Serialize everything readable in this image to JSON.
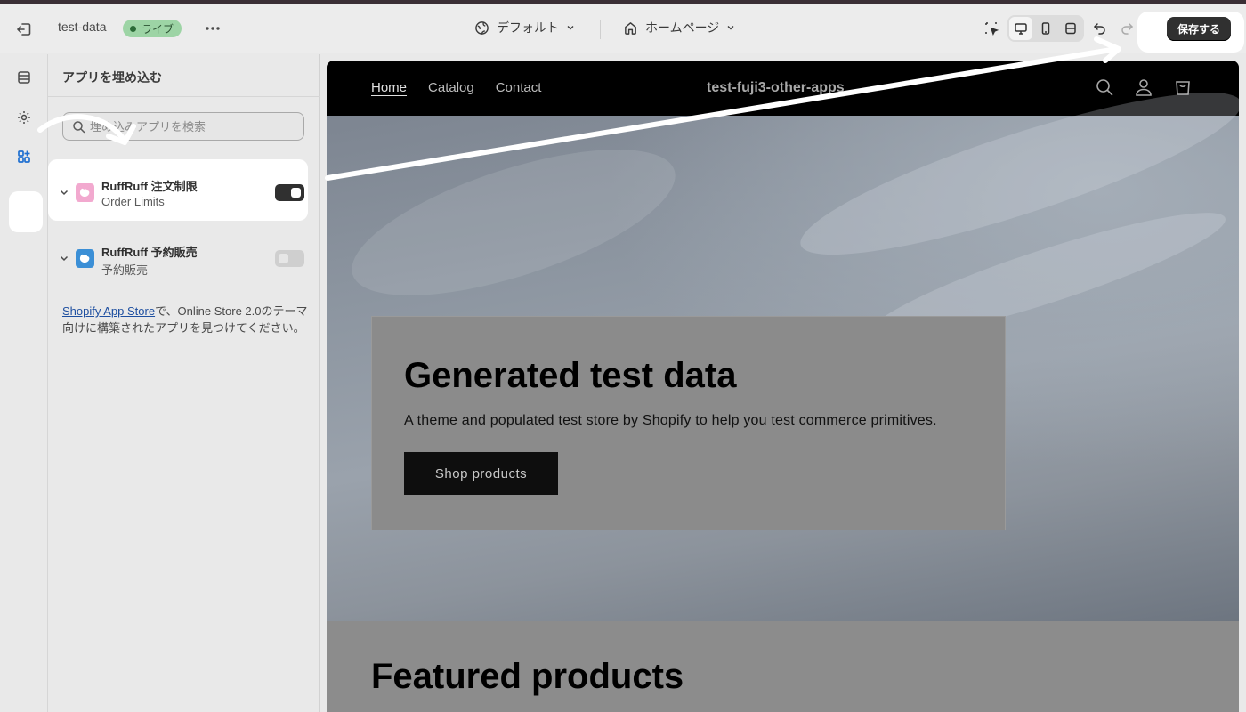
{
  "topbar": {
    "store_name": "test-data",
    "status_badge": "ライブ",
    "theme_selector": "デフォルト",
    "page_selector": "ホームページ",
    "save_label": "保存する"
  },
  "panel": {
    "title": "アプリを埋め込む",
    "search_placeholder": "埋め込みアプリを検索",
    "apps": [
      {
        "name": "RuffRuff 注文制限",
        "subtitle": "Order Limits",
        "enabled": true,
        "logo_color": "#f2a9cf"
      },
      {
        "name": "RuffRuff 予約販売",
        "subtitle": "予約販売",
        "enabled": false,
        "logo_color": "#3b8fd6"
      }
    ],
    "note_link": "Shopify App Store",
    "note_text": "で、Online Store 2.0のテーマ向けに構築されたアプリを見つけてください。"
  },
  "preview": {
    "nav": [
      "Home",
      "Catalog",
      "Contact"
    ],
    "brand": "test-fuji3-other-apps",
    "hero_title": "Generated test data",
    "hero_text": "A theme and populated test store by Shopify to help you test commerce primitives.",
    "hero_button": "Shop products",
    "featured_title": "Featured products"
  },
  "colors": {
    "save_button": "#303030",
    "live_badge": "#9dd4a5",
    "active_rail": "#1f6fd1",
    "annotation": "#ffffff"
  }
}
